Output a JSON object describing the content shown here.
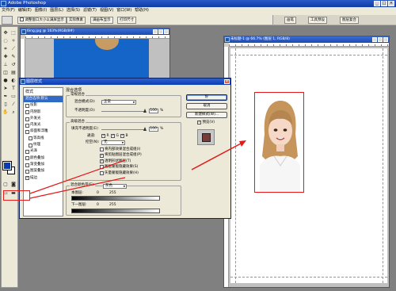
{
  "app": {
    "title": "Adobe Photoshop"
  },
  "menu": [
    "文件(F)",
    "编辑(E)",
    "图像(I)",
    "图层(L)",
    "选择(S)",
    "滤镜(T)",
    "视图(V)",
    "窗口(W)",
    "帮助(H)"
  ],
  "options": {
    "fit_all_windows": "调整窗口大小以满屏显示",
    "actual_pixels": "实际像素",
    "fit_screen": "满画布显示",
    "print_size": "打印尺寸"
  },
  "palette_tabs": [
    "画笔",
    "工具预设",
    "图层复合"
  ],
  "doc_left": {
    "title": "6ing.jpg @ 163%(RGB/8#)"
  },
  "doc_right": {
    "title": "未标题-1 @ 66.7% (图层 1, RGB/8)"
  },
  "dialog": {
    "title": "图层样式",
    "style_list_header": "样式",
    "style_items": [
      {
        "label": "混合选项:默认",
        "checked": null,
        "active": true,
        "indent": false
      },
      {
        "label": "投影",
        "checked": false,
        "active": false,
        "indent": false
      },
      {
        "label": "内阴影",
        "checked": false,
        "active": false,
        "indent": false
      },
      {
        "label": "外发光",
        "checked": false,
        "active": false,
        "indent": false
      },
      {
        "label": "内发光",
        "checked": false,
        "active": false,
        "indent": false
      },
      {
        "label": "斜面和浮雕",
        "checked": false,
        "active": false,
        "indent": false
      },
      {
        "label": "等高线",
        "checked": false,
        "active": false,
        "indent": true
      },
      {
        "label": "纹理",
        "checked": false,
        "active": false,
        "indent": true
      },
      {
        "label": "光泽",
        "checked": false,
        "active": false,
        "indent": false
      },
      {
        "label": "颜色叠加",
        "checked": false,
        "active": false,
        "indent": false
      },
      {
        "label": "渐变叠加",
        "checked": false,
        "active": false,
        "indent": false
      },
      {
        "label": "图案叠加",
        "checked": false,
        "active": false,
        "indent": false
      },
      {
        "label": "描边",
        "checked": true,
        "active": false,
        "indent": false
      }
    ],
    "blend": {
      "section_title": "混合选项",
      "general_group": "常规混合",
      "blend_mode_label": "混合模式(D):",
      "blend_mode_value": "正常",
      "opacity_label": "不透明度(O):",
      "opacity_value": "100",
      "percent": "%",
      "advanced_group": "高级混合",
      "fill_label": "填充不透明度(E):",
      "fill_value": "100",
      "channels_label": "通道:",
      "channels": [
        "R",
        "G",
        "B"
      ],
      "knockout_label": "挖空(N):",
      "knockout_value": "无",
      "advanced_options": [
        {
          "label": "将内部效果混合成组(I)",
          "checked": false
        },
        {
          "label": "将剪贴图层混合成组(P)",
          "checked": true
        },
        {
          "label": "透明形状图层(T)",
          "checked": true
        },
        {
          "label": "图层蒙版隐藏效果(S)",
          "checked": false
        },
        {
          "label": "矢量蒙版隐藏效果(H)",
          "checked": false
        }
      ],
      "blend_if_label": "混合颜色带(E):",
      "blend_if_value": "灰色",
      "this_layer_label": "本图层:",
      "this_layer_min": "0",
      "this_layer_max": "255",
      "underlying_label": "下一图层:",
      "underlying_min": "0",
      "underlying_max": "255"
    },
    "buttons": {
      "ok": "好",
      "cancel": "取消",
      "new_style": "新建样式(W)...",
      "preview": "预览(V)"
    }
  },
  "watermark": "Baidu经验"
}
